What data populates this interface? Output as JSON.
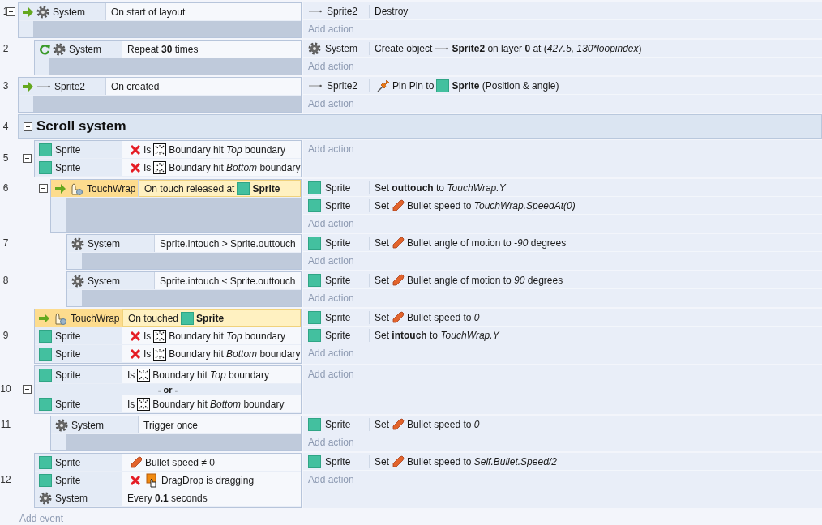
{
  "events": [
    {
      "kind": "event",
      "number": "1",
      "expanded": true,
      "conditions": [
        {
          "kind": "system",
          "object": "System",
          "trigger": true,
          "loop": false,
          "negated": false,
          "selected": false,
          "segments": [
            {
              "kind": "text",
              "text": "On start of layout"
            }
          ]
        }
      ],
      "actions": [
        {
          "kind": "line",
          "object": "Sprite2",
          "segments": [
            {
              "kind": "text",
              "text": "Destroy"
            }
          ]
        }
      ],
      "add_action": "Add action",
      "children": [
        {
          "kind": "event",
          "number": "2",
          "conditions": [
            {
              "kind": "system",
              "object": "System",
              "trigger": false,
              "loop": true,
              "negated": false,
              "selected": false,
              "segments": [
                {
                  "kind": "text",
                  "text": "Repeat **30** times"
                }
              ]
            }
          ],
          "actions": [
            {
              "kind": "system",
              "object": "System",
              "segments": [
                {
                  "kind": "text",
                  "text": "Create object"
                },
                {
                  "kind": "line"
                },
                {
                  "kind": "text",
                  "text": "**Sprite2** on layer **0** at ("
                },
                {
                  "kind": "italic",
                  "text": "427.5, 130*loopindex"
                },
                {
                  "kind": "text",
                  "text": ")"
                }
              ]
            }
          ],
          "add_action": "Add action"
        }
      ]
    },
    {
      "kind": "event",
      "number": "3",
      "conditions": [
        {
          "kind": "line",
          "object": "Sprite2",
          "trigger": true,
          "loop": false,
          "negated": false,
          "selected": false,
          "segments": [
            {
              "kind": "text",
              "text": "On created"
            }
          ]
        }
      ],
      "actions": [
        {
          "kind": "line",
          "object": "Sprite2",
          "segments": [
            {
              "kind": "pin"
            },
            {
              "kind": "text",
              "text": "Pin Pin to"
            },
            {
              "kind": "square"
            },
            {
              "kind": "text",
              "text": "**Sprite** (Position & angle)"
            }
          ]
        }
      ],
      "add_action": "Add action"
    },
    {
      "kind": "group",
      "number": "4",
      "expanded": true,
      "title": "Scroll system",
      "children": [
        {
          "kind": "event",
          "number": "5",
          "expanded": true,
          "conditions": [
            {
              "kind": "sprite",
              "object": "Sprite",
              "trigger": false,
              "loop": false,
              "negated": true,
              "selected": false,
              "segments": [
                {
                  "kind": "text",
                  "text": "Is"
                },
                {
                  "kind": "boundary"
                },
                {
                  "kind": "text",
                  "text": "Boundary hit *Top* boundary"
                }
              ]
            },
            {
              "kind": "sprite",
              "object": "Sprite",
              "trigger": false,
              "loop": false,
              "negated": true,
              "selected": false,
              "segments": [
                {
                  "kind": "text",
                  "text": "Is"
                },
                {
                  "kind": "boundary"
                },
                {
                  "kind": "text",
                  "text": "Boundary hit *Bottom* boundary"
                }
              ]
            }
          ],
          "add_action": "Add action",
          "children": [
            {
              "kind": "event",
              "number": "6",
              "expanded": true,
              "conditions": [
                {
                  "kind": "touch",
                  "object": "TouchWrap",
                  "trigger": true,
                  "loop": false,
                  "negated": false,
                  "selected": true,
                  "segments": [
                    {
                      "kind": "text",
                      "text": "On touch released at"
                    },
                    {
                      "kind": "square"
                    },
                    {
                      "kind": "text",
                      "text": "**Sprite**"
                    }
                  ]
                }
              ],
              "actions": [
                {
                  "kind": "sprite",
                  "object": "Sprite",
                  "segments": [
                    {
                      "kind": "text",
                      "text": "Set **outtouch** to *TouchWrap.Y*"
                    }
                  ]
                },
                {
                  "kind": "sprite",
                  "object": "Sprite",
                  "segments": [
                    {
                      "kind": "text",
                      "text": "Set"
                    },
                    {
                      "kind": "bullet"
                    },
                    {
                      "kind": "text",
                      "text": "Bullet speed to *TouchWrap.SpeedAt(0)*"
                    }
                  ]
                }
              ],
              "add_action": "Add action",
              "children": [
                {
                  "kind": "event",
                  "number": "7",
                  "conditions": [
                    {
                      "kind": "system",
                      "object": "System",
                      "trigger": false,
                      "loop": false,
                      "negated": false,
                      "selected": false,
                      "segments": [
                        {
                          "kind": "text",
                          "text": "Sprite.intouch > Sprite.outtouch"
                        }
                      ]
                    }
                  ],
                  "actions": [
                    {
                      "kind": "sprite",
                      "object": "Sprite",
                      "segments": [
                        {
                          "kind": "text",
                          "text": "Set"
                        },
                        {
                          "kind": "bullet"
                        },
                        {
                          "kind": "text",
                          "text": "Bullet angle of motion to *-90* degrees"
                        }
                      ]
                    }
                  ],
                  "add_action": "Add action"
                },
                {
                  "kind": "event",
                  "number": "8",
                  "conditions": [
                    {
                      "kind": "system",
                      "object": "System",
                      "trigger": false,
                      "loop": false,
                      "negated": false,
                      "selected": false,
                      "segments": [
                        {
                          "kind": "text",
                          "text": "Sprite.intouch ≤ Sprite.outtouch"
                        }
                      ]
                    }
                  ],
                  "actions": [
                    {
                      "kind": "sprite",
                      "object": "Sprite",
                      "segments": [
                        {
                          "kind": "text",
                          "text": "Set"
                        },
                        {
                          "kind": "bullet"
                        },
                        {
                          "kind": "text",
                          "text": "Bullet angle of motion to *90* degrees"
                        }
                      ]
                    }
                  ],
                  "add_action": "Add action"
                }
              ]
            }
          ]
        },
        {
          "kind": "event",
          "number": "9",
          "conditions": [
            {
              "kind": "touch",
              "object": "TouchWrap",
              "trigger": true,
              "loop": false,
              "negated": false,
              "selected": true,
              "segments": [
                {
                  "kind": "text",
                  "text": "On touched"
                },
                {
                  "kind": "square"
                },
                {
                  "kind": "text",
                  "text": "**Sprite**"
                }
              ]
            },
            {
              "kind": "sprite",
              "object": "Sprite",
              "trigger": false,
              "loop": false,
              "negated": true,
              "selected": false,
              "segments": [
                {
                  "kind": "text",
                  "text": "Is"
                },
                {
                  "kind": "boundary"
                },
                {
                  "kind": "text",
                  "text": "Boundary hit *Top* boundary"
                }
              ]
            },
            {
              "kind": "sprite",
              "object": "Sprite",
              "trigger": false,
              "loop": false,
              "negated": true,
              "selected": false,
              "segments": [
                {
                  "kind": "text",
                  "text": "Is"
                },
                {
                  "kind": "boundary"
                },
                {
                  "kind": "text",
                  "text": "Boundary hit *Bottom* boundary"
                }
              ]
            }
          ],
          "actions": [
            {
              "kind": "sprite",
              "object": "Sprite",
              "segments": [
                {
                  "kind": "text",
                  "text": "Set"
                },
                {
                  "kind": "bullet"
                },
                {
                  "kind": "text",
                  "text": "Bullet speed to *0*"
                }
              ]
            },
            {
              "kind": "sprite",
              "object": "Sprite",
              "segments": [
                {
                  "kind": "text",
                  "text": "Set **intouch** to *TouchWrap.Y*"
                }
              ]
            }
          ],
          "add_action": "Add action"
        },
        {
          "kind": "event",
          "number": "10",
          "expanded": true,
          "or_label": "- or -",
          "conditions": [
            {
              "kind": "sprite",
              "object": "Sprite",
              "trigger": false,
              "loop": false,
              "negated": false,
              "selected": false,
              "segments": [
                {
                  "kind": "text",
                  "text": "Is"
                },
                {
                  "kind": "boundary"
                },
                {
                  "kind": "text",
                  "text": "Boundary hit *Top* boundary"
                }
              ]
            },
            {
              "kind": "sprite",
              "object": "Sprite",
              "trigger": false,
              "loop": false,
              "negated": false,
              "selected": false,
              "segments": [
                {
                  "kind": "text",
                  "text": "Is"
                },
                {
                  "kind": "boundary"
                },
                {
                  "kind": "text",
                  "text": "Boundary hit *Bottom* boundary"
                }
              ]
            }
          ],
          "add_action": "Add action",
          "children": [
            {
              "kind": "event",
              "number": "11",
              "conditions": [
                {
                  "kind": "system",
                  "object": "System",
                  "trigger": false,
                  "loop": false,
                  "negated": false,
                  "selected": false,
                  "segments": [
                    {
                      "kind": "text",
                      "text": "Trigger once"
                    }
                  ]
                }
              ],
              "actions": [
                {
                  "kind": "sprite",
                  "object": "Sprite",
                  "segments": [
                    {
                      "kind": "text",
                      "text": "Set"
                    },
                    {
                      "kind": "bullet"
                    },
                    {
                      "kind": "text",
                      "text": "Bullet speed to *0*"
                    }
                  ]
                }
              ],
              "add_action": "Add action"
            }
          ]
        },
        {
          "kind": "event",
          "number": "12",
          "conditions": [
            {
              "kind": "sprite",
              "object": "Sprite",
              "trigger": false,
              "loop": false,
              "negated": false,
              "selected": false,
              "segments": [
                {
                  "kind": "bullet"
                },
                {
                  "kind": "text",
                  "text": "Bullet speed ≠ 0"
                }
              ]
            },
            {
              "kind": "sprite",
              "object": "Sprite",
              "trigger": false,
              "loop": false,
              "negated": true,
              "selected": false,
              "segments": [
                {
                  "kind": "drag"
                },
                {
                  "kind": "text",
                  "text": "DragDrop is dragging"
                }
              ]
            },
            {
              "kind": "system",
              "object": "System",
              "trigger": false,
              "loop": false,
              "negated": false,
              "selected": false,
              "segments": [
                {
                  "kind": "text",
                  "text": "Every **0.1** seconds"
                }
              ]
            }
          ],
          "actions": [
            {
              "kind": "sprite",
              "object": "Sprite",
              "segments": [
                {
                  "kind": "text",
                  "text": "Set"
                },
                {
                  "kind": "bullet"
                },
                {
                  "kind": "text",
                  "text": "Bullet speed to *Self.Bullet.Speed/2*"
                }
              ]
            }
          ],
          "add_action": "Add action"
        }
      ]
    }
  ],
  "add_event": "Add event"
}
